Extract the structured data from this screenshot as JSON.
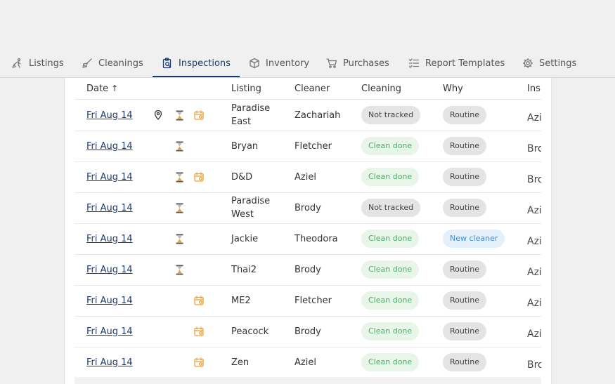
{
  "tabs": [
    {
      "label": "Listings",
      "icon": "broom-person-icon"
    },
    {
      "label": "Cleanings",
      "icon": "broom-icon"
    },
    {
      "label": "Inspections",
      "icon": "clipboard-search-icon",
      "active": true
    },
    {
      "label": "Inventory",
      "icon": "box-icon"
    },
    {
      "label": "Purchases",
      "icon": "cart-icon"
    },
    {
      "label": "Report Templates",
      "icon": "checklist-icon"
    },
    {
      "label": "Settings",
      "icon": "gear-icon"
    }
  ],
  "table": {
    "columns": {
      "date": "Date",
      "date_sort_indicator": "↑",
      "listing": "Listing",
      "cleaner": "Cleaner",
      "cleaning": "Cleaning",
      "why": "Why",
      "inspector": "Ins"
    },
    "rows": [
      {
        "date": "Fri Aug 14",
        "icons": [
          "location-pin-icon",
          "hourglass-icon",
          "calendar-icon"
        ],
        "listing": "Paradise East",
        "cleaner": "Zachariah",
        "cleaning": "Not tracked",
        "cleaning_status": "grey",
        "why": "Routine",
        "why_status": "grey",
        "inspector": "Azi"
      },
      {
        "date": "Fri Aug 14",
        "icons": [
          "hourglass-icon"
        ],
        "listing": "Bryan",
        "cleaner": "Fletcher",
        "cleaning": "Clean done",
        "cleaning_status": "green",
        "why": "Routine",
        "why_status": "grey",
        "inspector": "Bro"
      },
      {
        "date": "Fri Aug 14",
        "icons": [
          "hourglass-icon",
          "calendar-icon"
        ],
        "listing": "D&D",
        "cleaner": "Aziel",
        "cleaning": "Clean done",
        "cleaning_status": "green",
        "why": "Routine",
        "why_status": "grey",
        "inspector": "Bro"
      },
      {
        "date": "Fri Aug 14",
        "icons": [
          "hourglass-icon"
        ],
        "listing": "Paradise West",
        "cleaner": "Brody",
        "cleaning": "Not tracked",
        "cleaning_status": "grey",
        "why": "Routine",
        "why_status": "grey",
        "inspector": "Azi"
      },
      {
        "date": "Fri Aug 14",
        "icons": [
          "hourglass-icon"
        ],
        "listing": "Jackie",
        "cleaner": "Theodora",
        "cleaning": "Clean done",
        "cleaning_status": "green",
        "why": "New cleaner",
        "why_status": "blue",
        "inspector": "Azi"
      },
      {
        "date": "Fri Aug 14",
        "icons": [
          "hourglass-icon"
        ],
        "listing": "Thai2",
        "cleaner": "Brody",
        "cleaning": "Clean done",
        "cleaning_status": "green",
        "why": "Routine",
        "why_status": "grey",
        "inspector": "Azi"
      },
      {
        "date": "Fri Aug 14",
        "icons": [
          "calendar-icon"
        ],
        "listing": "ME2",
        "cleaner": "Fletcher",
        "cleaning": "Clean done",
        "cleaning_status": "green",
        "why": "Routine",
        "why_status": "grey",
        "inspector": "Azi"
      },
      {
        "date": "Fri Aug 14",
        "icons": [
          "calendar-icon"
        ],
        "listing": "Peacock",
        "cleaner": "Brody",
        "cleaning": "Clean done",
        "cleaning_status": "green",
        "why": "Routine",
        "why_status": "grey",
        "inspector": "Azi"
      },
      {
        "date": "Fri Aug 14",
        "icons": [
          "calendar-icon"
        ],
        "listing": "Zen",
        "cleaner": "Aziel",
        "cleaning": "Clean done",
        "cleaning_status": "green",
        "why": "Routine",
        "why_status": "grey",
        "inspector": "Bro"
      }
    ]
  },
  "colors": {
    "accent": "#1b3b6f",
    "status_orange": "#f0a030",
    "badge_green_text": "#4caf6a",
    "badge_blue_text": "#3b8fd6"
  }
}
